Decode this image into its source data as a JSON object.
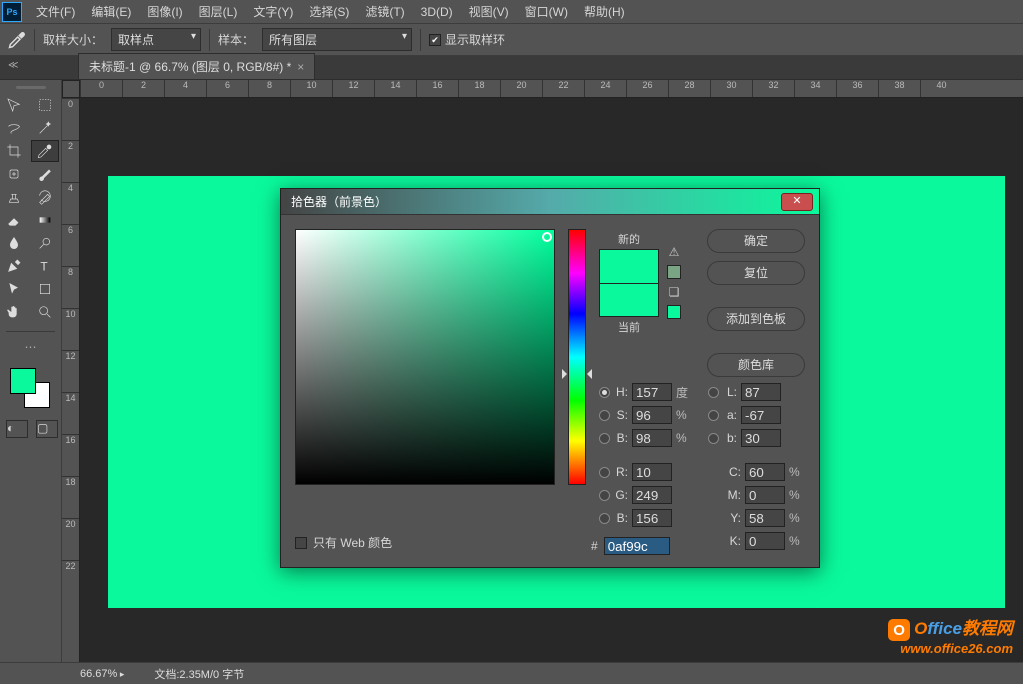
{
  "menu": {
    "items": [
      "文件(F)",
      "编辑(E)",
      "图像(I)",
      "图层(L)",
      "文字(Y)",
      "选择(S)",
      "滤镜(T)",
      "3D(D)",
      "视图(V)",
      "窗口(W)",
      "帮助(H)"
    ]
  },
  "optbar": {
    "sample_size_label": "取样大小：",
    "sample_size_value": "取样点",
    "sample_label": "样本：",
    "sample_value": "所有图层",
    "show_ring": "显示取样环",
    "ring_checked": true
  },
  "doc": {
    "tab_title": "未标题-1 @ 66.7% (图层 0, RGB/8#) *"
  },
  "ruler_h": [
    "0",
    "2",
    "4",
    "6",
    "8",
    "10",
    "12",
    "14",
    "16",
    "18",
    "20",
    "22",
    "24",
    "26",
    "28",
    "30",
    "32",
    "34",
    "36",
    "38",
    "40"
  ],
  "ruler_v": [
    "0",
    "2",
    "4",
    "6",
    "8",
    "10",
    "12",
    "14",
    "16",
    "18",
    "20",
    "22"
  ],
  "dialog": {
    "title": "拾色器（前景色）",
    "new_label": "新的",
    "current_label": "当前",
    "btn_ok": "确定",
    "btn_reset": "复位",
    "btn_add": "添加到色板",
    "btn_lib": "颜色库",
    "H": "157",
    "H_unit": "度",
    "S": "96",
    "S_unit": "%",
    "Bv": "98",
    "B_unit": "%",
    "R": "10",
    "G": "249",
    "B": "156",
    "L": "87",
    "a": "-67",
    "b_lab": "30",
    "C": "60",
    "C_unit": "%",
    "M": "0",
    "M_unit": "%",
    "Y": "58",
    "Y_unit": "%",
    "K": "0",
    "K_unit": "%",
    "hex": "0af99c",
    "web_only": "只有 Web 颜色",
    "hash": "#"
  },
  "status": {
    "zoom": "66.67%",
    "doc": "文档:2.35M/0 字节"
  },
  "watermark": {
    "line1a": "O",
    "line1b": "ffice",
    "line1c": "教程网",
    "line2": "www.office26.com"
  },
  "colors": {
    "fg": "#0af99c",
    "bg": "#ffffff"
  }
}
